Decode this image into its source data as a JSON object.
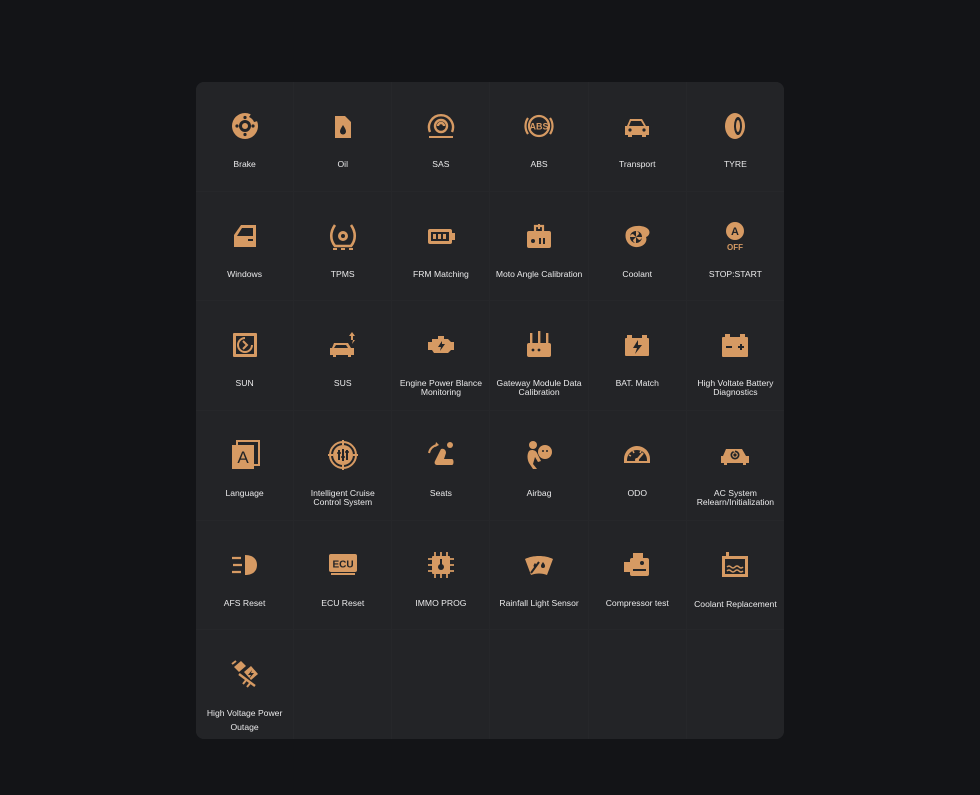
{
  "accent_color": "#d69a63",
  "functions": [
    {
      "icon": "brake-disc-icon",
      "label": "Brake"
    },
    {
      "icon": "oil-can-icon",
      "label": "Oil"
    },
    {
      "icon": "steering-angle-sensor-icon",
      "label": "SAS"
    },
    {
      "icon": "abs-warning-icon",
      "label": "ABS"
    },
    {
      "icon": "transport-car-icon",
      "label": "Transport"
    },
    {
      "icon": "tyre-icon",
      "label": "TYRE"
    },
    {
      "icon": "car-window-icon",
      "label": "Windows"
    },
    {
      "icon": "tpms-warning-icon",
      "label": "TPMS"
    },
    {
      "icon": "battery-module-icon",
      "label": "FRM Matching"
    },
    {
      "icon": "motor-module-icon",
      "label": "Moto Angle Calibration"
    },
    {
      "icon": "coolant-fan-icon",
      "label": "Coolant"
    },
    {
      "icon": "auto-stop-start-off-icon",
      "label": "STOP:START"
    },
    {
      "icon": "sunroof-icon",
      "label": "SUN"
    },
    {
      "icon": "suspension-car-icon",
      "label": "SUS"
    },
    {
      "icon": "engine-warning-icon",
      "label": "Engine Power Blance Monitoring"
    },
    {
      "icon": "gateway-router-icon",
      "label": "Gateway Module Data Calibration"
    },
    {
      "icon": "battery-lightning-icon",
      "label": "BAT. Match"
    },
    {
      "icon": "hv-battery-icon",
      "label": "High Voltate Battery Diagnostics"
    },
    {
      "icon": "language-a-icon",
      "label": "Language"
    },
    {
      "icon": "cruise-control-icon",
      "label": "Intelligent Cruise Control System"
    },
    {
      "icon": "seat-adjust-icon",
      "label": "Seats"
    },
    {
      "icon": "airbag-icon",
      "label": "Airbag"
    },
    {
      "icon": "odometer-gauge-icon",
      "label": "ODO"
    },
    {
      "icon": "ac-car-icon",
      "label": "AC System Relearn/Initialization"
    },
    {
      "icon": "headlight-afs-icon",
      "label": "AFS Reset"
    },
    {
      "icon": "ecu-chip-icon",
      "label": "ECU Reset"
    },
    {
      "icon": "immobilizer-chip-icon",
      "label": "IMMO PROG"
    },
    {
      "icon": "rain-light-sensor-icon",
      "label": "Rainfall Light Sensor"
    },
    {
      "icon": "compressor-icon",
      "label": "Compressor test"
    },
    {
      "icon": "coolant-level-icon",
      "label": "Coolant Replacement"
    },
    {
      "icon": "high-voltage-plug-icon",
      "label": "High Voltage Power Outage"
    }
  ]
}
